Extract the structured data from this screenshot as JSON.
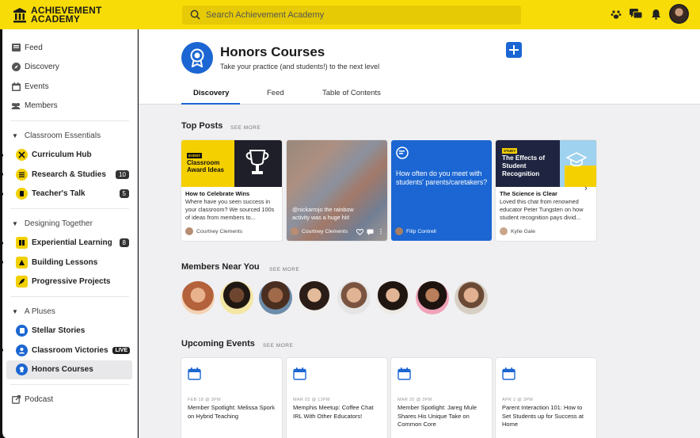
{
  "app": {
    "name_line1": "ACHIEVEMENT",
    "name_line2": "ACADEMY"
  },
  "search": {
    "placeholder": "Search Achievement Academy"
  },
  "colors": {
    "brand_yellow": "#f8dc07",
    "accent_blue": "#1b66d2"
  },
  "sidebar": {
    "nav": [
      {
        "label": "Feed",
        "icon": "feed-icon"
      },
      {
        "label": "Discovery",
        "icon": "compass-icon"
      },
      {
        "label": "Events",
        "icon": "calendar-icon"
      },
      {
        "label": "Members",
        "icon": "people-icon"
      }
    ],
    "groups": [
      {
        "label": "Classroom Essentials",
        "items": [
          {
            "label": "Curriculum Hub",
            "count": ""
          },
          {
            "label": "Research & Studies",
            "count": "10"
          },
          {
            "label": "Teacher's Talk",
            "count": "5"
          }
        ]
      },
      {
        "label": "Designing Together",
        "items": [
          {
            "label": "Experiential Learning",
            "count": "8"
          },
          {
            "label": "Building Lessons",
            "count": ""
          },
          {
            "label": "Progressive Projects",
            "count": ""
          }
        ]
      },
      {
        "label": "A Pluses",
        "items": [
          {
            "label": "Stellar Stories",
            "count": ""
          },
          {
            "label": "Classroom Victories",
            "badge": "LIVE"
          },
          {
            "label": "Honors Courses",
            "count": ""
          }
        ]
      }
    ],
    "podcast": "Podcast"
  },
  "header": {
    "title": "Honors Courses",
    "subtitle": "Take your practice (and students!) to the next level",
    "tabs": [
      "Discovery",
      "Feed",
      "Table of Contents"
    ]
  },
  "top_posts": {
    "title": "Top Posts",
    "see_more": "SEE MORE",
    "cards": [
      {
        "image_tag": "EVENT",
        "image_text": "Classroom Award Ideas",
        "title": "How to Celebrate Wins",
        "desc": "Where have you seen success in your classroom? We sourced 100s of ideas from members to...",
        "author": "Courtney Clements"
      },
      {
        "overlay": "@nickarrojo the rainbow activity was a huge hit!",
        "author": "Courtney Clements"
      },
      {
        "question": "How often do you meet with students' parents/caretakers?",
        "author": "Filip Contrell"
      },
      {
        "image_tag": "STUDY",
        "image_text": "The Effects of Student Recognition",
        "title": "The Science is Clear",
        "desc": "Loved this chat from renowned educator Peter Tungsten on how student recognition pays divid...",
        "author": "Kylie Gale"
      }
    ]
  },
  "members": {
    "title": "Members Near You",
    "see_more": "SEE MORE"
  },
  "events": {
    "title": "Upcoming Events",
    "see_more": "SEE MORE",
    "items": [
      {
        "date": "FEB 18 @ 3PM",
        "title": "Member Spotlight: Melissa Spork on Hybrid Teaching"
      },
      {
        "date": "MAR 03 @ 12PM",
        "title": "Memphis Meetup: Coffee Chat IRL With Other Educators!"
      },
      {
        "date": "MAR 20 @ 3PM",
        "title": "Member Spotlight: Jareg Mule Shares His Unique Take on Common Core"
      },
      {
        "date": "APR 2 @ 3PM",
        "title": "Parent Interaction 101: How to Set Students up for Success at Home"
      }
    ]
  }
}
